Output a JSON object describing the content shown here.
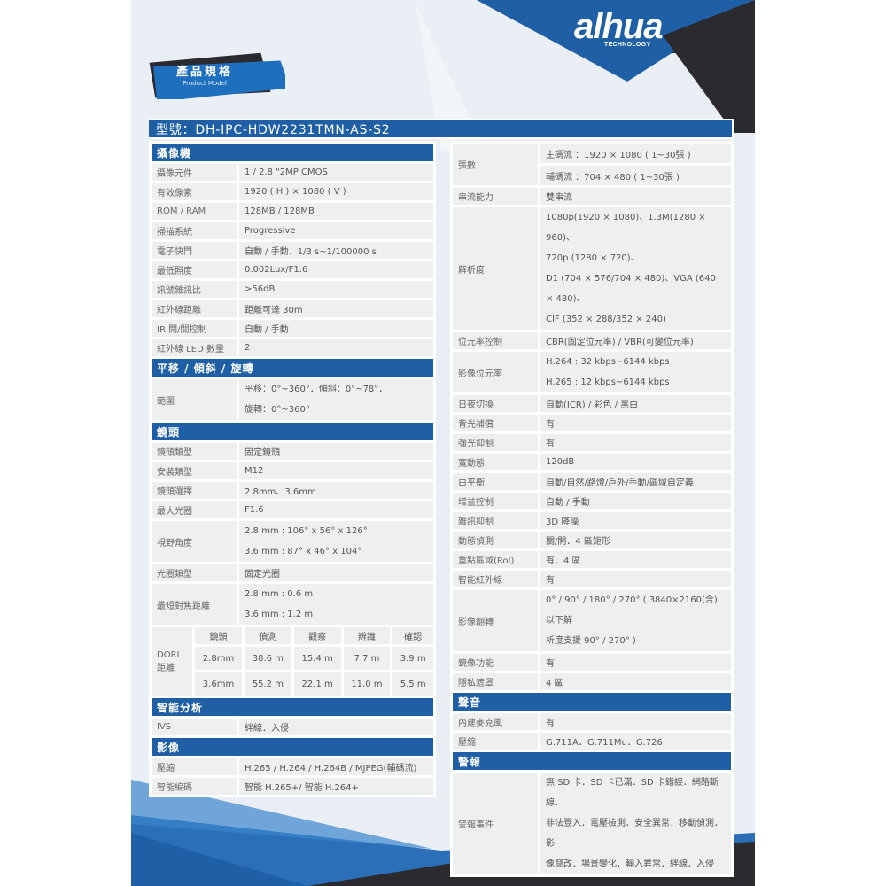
{
  "brand": {
    "name": "alhua",
    "tagline": "TECHNOLOGY"
  },
  "badge": {
    "title": "產品規格",
    "subtitle": "Product Model"
  },
  "model": "型號：DH-IPC-HDW2231TMN-AS-S2",
  "left": {
    "camera": {
      "title": "攝像機",
      "rows": [
        {
          "k": "攝像元件",
          "v": "1 / 2.8 \"2MP CMOS"
        },
        {
          "k": "有效像素",
          "v": "1920 ( H ) × 1080 ( V )"
        },
        {
          "k": "ROM / RAM",
          "v": "128MB / 128MB"
        },
        {
          "k": "掃描系統",
          "v": "Progressive"
        },
        {
          "k": "電子快門",
          "v": "自動 / 手動．1/3 s~1/100000 s"
        },
        {
          "k": "最低照度",
          "v": "0.002Lux/F1.6"
        },
        {
          "k": "訊號雜訊比",
          "v": ">56dB"
        },
        {
          "k": "紅外線距離",
          "v": "距離可達 30m"
        },
        {
          "k": "IR 開/關控制",
          "v": "自動 / 手動"
        },
        {
          "k": "紅外線 LED 數量",
          "v": "2"
        }
      ]
    },
    "ptz": {
      "title": "平移 / 傾斜 / 旋轉",
      "range_label": "範圍",
      "range_lines": [
        "平移：0°~360°．傾斜：0°~78°．",
        "旋轉：0°~360°"
      ]
    },
    "lens": {
      "title": "鏡頭",
      "rows": [
        {
          "k": "鏡頭類型",
          "v": "固定鏡頭"
        },
        {
          "k": "安裝類型",
          "v": "M12"
        },
        {
          "k": "鏡頭選擇",
          "v": "2.8mm、3.6mm"
        },
        {
          "k": "最大光圈",
          "v": "F1.6"
        }
      ],
      "fov_label": "視野角度",
      "fov_lines": [
        "2.8 mm : 106° x 56° x 126°",
        "3.6 mm : 87° x 46° x 104°"
      ],
      "iris_label": "光圈類型",
      "iris_value": "固定光圈",
      "focus_label": "最短對焦距離",
      "focus_lines": [
        "2.8 mm : 0.6 m",
        "3.6 mm : 1.2 m"
      ]
    },
    "dori": {
      "label_1": "DORI",
      "label_2": "距離",
      "headers": [
        "鏡頭",
        "偵測",
        "觀察",
        "辨識",
        "確認"
      ],
      "rows": [
        [
          "2.8mm",
          "38.6 m",
          "15.4 m",
          "7.7 m",
          "3.9 m"
        ],
        [
          "3.6mm",
          "55.2 m",
          "22.1 m",
          "11.0 m",
          "5.5 m"
        ]
      ]
    },
    "analytics": {
      "title": "智能分析",
      "rows": [
        {
          "k": "IVS",
          "v": "絆線．入侵"
        }
      ]
    },
    "video": {
      "title": "影像",
      "rows": [
        {
          "k": "壓縮",
          "v": "H.265 / H.264 / H.264B / MJPEG(輔碼流)"
        },
        {
          "k": "智能編碼",
          "v": "智能 H.265+/ 智能 H.264+"
        }
      ]
    }
  },
  "right": {
    "fps_label": "張數",
    "fps_lines": [
      "主碼流 ：1920 × 1080 ( 1~30張 )",
      "輔碼流 ：704 × 480 ( 1~30張 )"
    ],
    "stream_label": "串流能力",
    "stream_value": "雙串流",
    "res_label": "解析度",
    "res_lines": [
      "1080p(1920 × 1080)、1.3M(1280 × 960)、",
      "720p (1280 × 720)、",
      "D1 (704 × 576/704 × 480)、VGA (640 × 480)、",
      "CIF (352 × 288/352 × 240)"
    ],
    "brc_label": "位元率控制",
    "brc_value": "CBR(固定位元率) / VBR(可變位元率)",
    "bitrate_label": "影像位元率",
    "bitrate_lines": [
      "H.264 : 32 kbps~6144 kbps",
      "H.265 : 12 kbps~6144 kbps"
    ],
    "rows_a": [
      {
        "k": "日夜切換",
        "v": "自動(ICR) / 彩色 / 黑白"
      },
      {
        "k": "背光補償",
        "v": "有"
      },
      {
        "k": "強光抑制",
        "v": "有"
      },
      {
        "k": "寬動態",
        "v": "120dB"
      },
      {
        "k": "白平衡",
        "v": "自動/自然/路燈/戶外/手動/區域自定義"
      },
      {
        "k": "增益控制",
        "v": "自動 / 手動"
      },
      {
        "k": "雜訊抑制",
        "v": "3D 降噪"
      },
      {
        "k": "動態偵測",
        "v": "關/開．4 區矩形"
      },
      {
        "k": "重點區域(RoI)",
        "v": "有．4 區"
      },
      {
        "k": "智能紅外線",
        "v": "有"
      }
    ],
    "flip_label": "影像翻轉",
    "flip_lines": [
      "0° / 90° / 180° / 270° ( 3840×2160(含)以下解",
      "析度支援 90° / 270° )"
    ],
    "rows_b": [
      {
        "k": "鏡像功能",
        "v": "有"
      },
      {
        "k": "隱私遮罩",
        "v": "4 區"
      }
    ],
    "audio": {
      "title": "聲音",
      "rows": [
        {
          "k": "內建麥克風",
          "v": "有"
        },
        {
          "k": "壓縮",
          "v": "G.711A．G.711Mu．G.726"
        }
      ]
    },
    "alarm": {
      "title": "警報",
      "label": "警報事件",
      "lines": [
        "無 SD 卡．SD 卡已滿．SD 卡錯誤．網路斷線．",
        "非法登入．電壓檢測．安全異常．移動偵測．影",
        "像竄改．場景變化．輸入異常．絆線．入侵"
      ]
    }
  },
  "colors": {
    "accent": "#1f5fa6",
    "dark": "#2b2a2e",
    "cell": "#efefef"
  }
}
